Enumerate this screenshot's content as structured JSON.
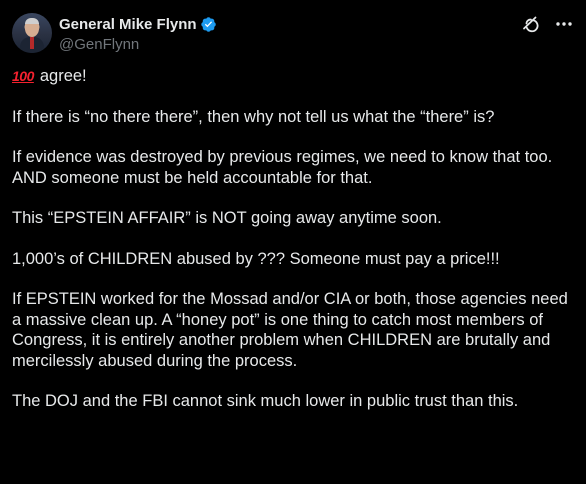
{
  "author": {
    "display_name": "General Mike Flynn",
    "handle": "@GenFlynn",
    "verified": true,
    "verified_color": "#1d9bf0"
  },
  "icons": {
    "header_actions": [
      "grok-icon",
      "more-icon"
    ],
    "emoji": "hundred-points-emoji"
  },
  "tweet": {
    "emoji_text": "100",
    "paragraphs": [
      "agree!",
      "If there is “no there there”, then why not tell us what the “there” is?",
      "If evidence was destroyed by previous regimes, we need to know that too. AND someone must be held accountable for that.",
      "This “EPSTEIN AFFAIR” is NOT going away anytime soon.",
      "1,000’s of CHILDREN abused by ??? Someone must pay a price!!!",
      "If EPSTEIN worked for the Mossad and/or CIA or both, those agencies need a massive clean up. A “honey pot” is one thing to catch most members of Congress, it is entirely another problem when CHILDREN are brutally and mercilessly abused during the process.",
      "The DOJ and the FBI cannot sink much lower in public trust than this."
    ]
  },
  "colors": {
    "background": "#000000",
    "text_primary": "#e7e9ea",
    "text_secondary": "#71767b",
    "link": "#1d9bf0"
  }
}
